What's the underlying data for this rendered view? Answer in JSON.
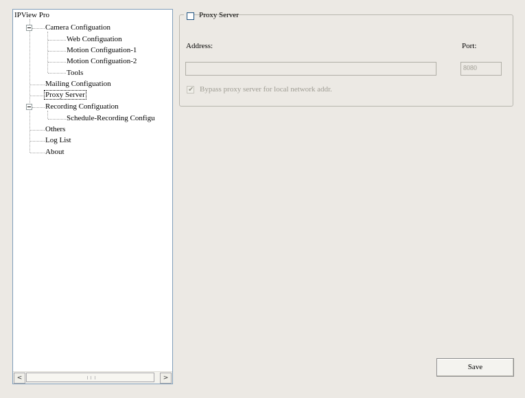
{
  "tree": {
    "root": "IPView Pro",
    "camera_configuration": "Camera Configuation",
    "web_configuration": "Web Configuation",
    "motion_configuration_1": "Motion Configuation-1",
    "motion_configuration_2": "Motion Configuation-2",
    "tools": "Tools",
    "mailing_configuration": "Mailing Configuation",
    "proxy_server": "Proxy Server",
    "recording_configuration": "Recording Configuation",
    "schedule_recording": "Schedule-Recording Configu",
    "others": "Others",
    "log_list": "Log List",
    "about": "About",
    "selected": "Proxy Server"
  },
  "scrollbar": {
    "left_arrow": "<",
    "right_arrow": ">"
  },
  "proxy": {
    "group_label": "Proxy Server",
    "enabled": false,
    "address_label": "Address:",
    "address_value": "",
    "port_label": "Port:",
    "port_value": "8080",
    "bypass_label": "Bypass proxy server for local network addr.",
    "bypass_checked": true
  },
  "actions": {
    "save_label": "Save"
  }
}
